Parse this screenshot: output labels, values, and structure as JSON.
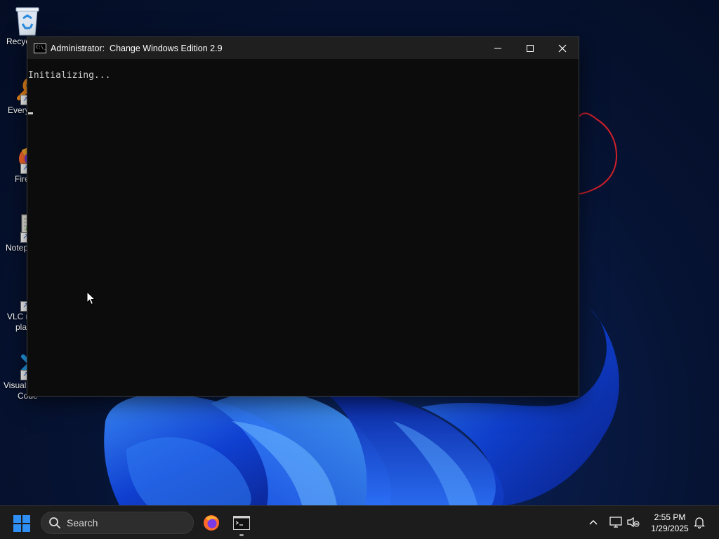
{
  "desktop": {
    "icons": [
      {
        "label": "Recycle Bin",
        "icon": "recycle-bin-icon",
        "visible_label": "Recyc"
      },
      {
        "label": "Everything",
        "icon": "everything-search-icon",
        "visible_label": "Every"
      },
      {
        "label": "Firefox",
        "icon": "firefox-icon",
        "visible_label": "Fire"
      },
      {
        "label": "Notepad++",
        "icon": "notepad-plus-plus-icon",
        "visible_label": "Notep"
      },
      {
        "label": "VLC media player",
        "icon": "vlc-icon",
        "visible_label_line1": "VLC r",
        "visible_label_line2": "pla"
      },
      {
        "label": "Visual Studio Code",
        "icon": "vscode-icon",
        "visible_label_line1": "Visual",
        "visible_label_line2": "Code"
      }
    ]
  },
  "console": {
    "title": "Administrator:  Change Windows Edition 2.9",
    "output": "Initializing...",
    "icon": "cmd-icon",
    "background": "#0c0c0c",
    "text_color": "#cccccc"
  },
  "taskbar": {
    "search_placeholder": "Search",
    "apps": [
      {
        "name": "Firefox",
        "icon": "firefox-icon"
      },
      {
        "name": "Command Prompt",
        "icon": "cmd-icon",
        "active": true
      }
    ],
    "tray": {
      "time": "2:55 PM",
      "date": "1/29/2025"
    }
  },
  "colors": {
    "taskbar": "#1c1c1c",
    "accent": "#2f8ff5",
    "annotation": "#d0202a"
  }
}
